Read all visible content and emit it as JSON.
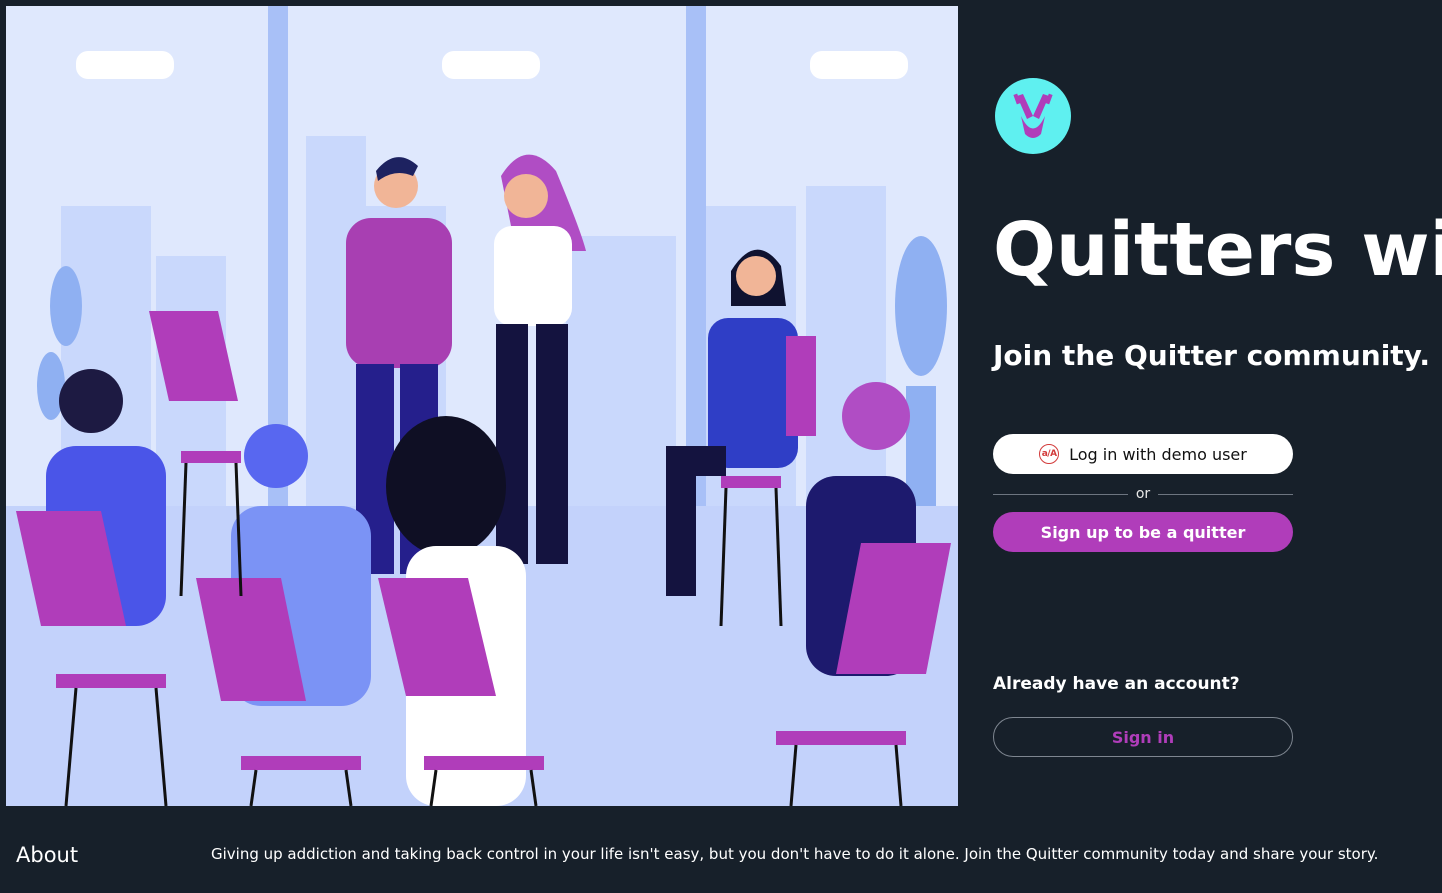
{
  "app": {
    "title": "Quitters win",
    "subtitle": "Join the Quitter community."
  },
  "auth": {
    "demo_login_label": "Log in with demo user",
    "demo_login_icon": "app-academy-icon",
    "divider_label": "or",
    "signup_label": "Sign up to be a quitter",
    "already_account_label": "Already have an account?",
    "signin_label": "Sign in"
  },
  "footer": {
    "about_label": "About",
    "about_text": "Giving up addiction and taking back control in your life isn't easy, but you don't have to do it alone. Join the Quitter community today and share your story."
  },
  "colors": {
    "background": "#17202a",
    "accent": "#b03dba",
    "logo_bg": "#5ff0f0",
    "hero_bg": "#dce6fb"
  }
}
